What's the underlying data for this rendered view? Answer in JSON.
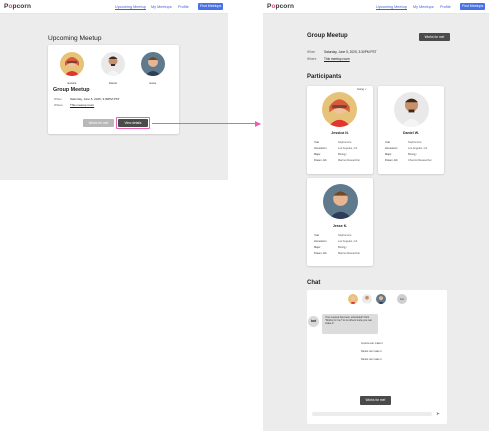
{
  "nav": {
    "logo": "Popcorn",
    "links": [
      "Upcoming Meetup",
      "My Meetups",
      "Profile"
    ],
    "cta": "Find Meetups",
    "cta_left": "Find Meetups"
  },
  "left": {
    "title": "Upcoming Meetup",
    "participants": [
      "Jessica",
      "Daniel",
      "Jesse"
    ],
    "group_title": "Group Meetup",
    "when_label": "When",
    "when_value": "Saturday, June 5, 2025, 3:30PM PST",
    "where_label": "Where",
    "where_value": "This meetup room",
    "works_btn": "Works for me!",
    "view_btn": "View details"
  },
  "right": {
    "title": "Group Meetup",
    "works_btn": "Works for me!",
    "when_label": "When",
    "when_value": "Saturday, June 5, 2025, 3:30PM PST",
    "where_label": "Where",
    "where_value": "This meetup room",
    "participants_title": "Participants",
    "going_label": "Going",
    "people": [
      {
        "name": "Jessica N.",
        "rows": [
          {
            "k": "Year",
            "v": "Sophomore"
          },
          {
            "k": "Hometown",
            "v": "Los Angeles, CA"
          },
          {
            "k": "Major",
            "v": "Biology"
          },
          {
            "k": "Dream Job",
            "v": "Marine Researcher"
          }
        ]
      },
      {
        "name": "Daniel W.",
        "rows": [
          {
            "k": "Year",
            "v": "Sophomore"
          },
          {
            "k": "Hometown",
            "v": "Los Angeles, CA"
          },
          {
            "k": "Major",
            "v": "Biology"
          },
          {
            "k": "Dream Job",
            "v": "Chemist Researcher"
          }
        ]
      },
      {
        "name": "Jesse K.",
        "rows": [
          {
            "k": "Year",
            "v": "Sophomore"
          },
          {
            "k": "Hometown",
            "v": "Los Angeles, CA"
          },
          {
            "k": "Major",
            "v": "Biology"
          },
          {
            "k": "Dream Job",
            "v": "Marine Researcher"
          }
        ]
      }
    ],
    "chat_title": "Chat",
    "bot_label": "bot",
    "bot_message": "Your meetup has been scheduled! Click \"Works for me!\" to let others know you can make it!",
    "system_messages": [
      "Jessica can make it",
      "Daniel can make it",
      "Daniel can make it"
    ],
    "chat_works_btn": "Works for me!",
    "send_icon": "send-icon"
  },
  "colors": {
    "accent": "#3d63d8",
    "cta": "#4a72e8",
    "highlight": "#e85fb6",
    "logo_accent": "#e8477f"
  }
}
